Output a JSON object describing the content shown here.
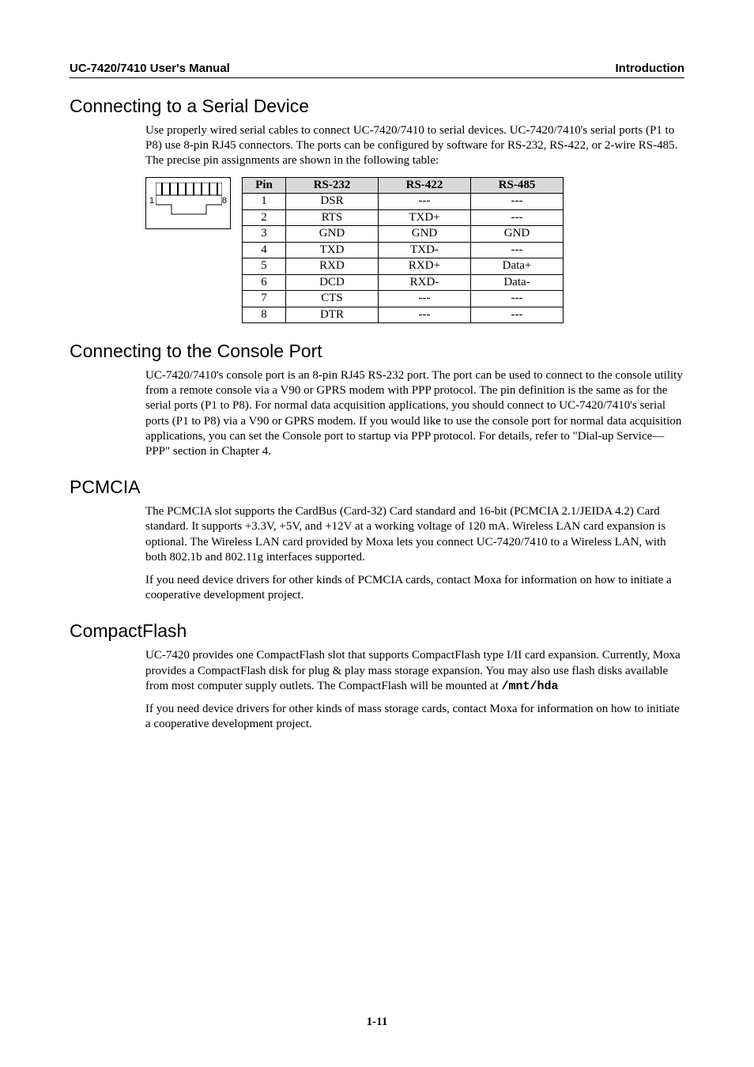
{
  "header": {
    "left": "UC-7420/7410 User's Manual",
    "right": "Introduction"
  },
  "sec1": {
    "title": "Connecting to a Serial Device",
    "para": "Use properly wired serial cables to connect UC-7420/7410 to serial devices. UC-7420/7410's serial ports (P1 to P8) use 8-pin RJ45 connectors. The ports can be configured by software for RS-232, RS-422, or 2-wire RS-485. The precise pin assignments are shown in the following table:"
  },
  "connector": {
    "left_num": "1",
    "right_num": "8"
  },
  "chart_data": {
    "type": "table",
    "title": "RJ45 serial pin assignments",
    "columns": [
      "Pin",
      "RS-232",
      "RS-422",
      "RS-485"
    ],
    "rows": [
      [
        "1",
        "DSR",
        "---",
        "---"
      ],
      [
        "2",
        "RTS",
        "TXD+",
        "---"
      ],
      [
        "3",
        "GND",
        "GND",
        "GND"
      ],
      [
        "4",
        "TXD",
        "TXD-",
        "---"
      ],
      [
        "5",
        "RXD",
        "RXD+",
        "Data+"
      ],
      [
        "6",
        "DCD",
        "RXD-",
        "Data-"
      ],
      [
        "7",
        "CTS",
        "---",
        "---"
      ],
      [
        "8",
        "DTR",
        "---",
        "---"
      ]
    ]
  },
  "sec2": {
    "title": "Connecting to the Console Port",
    "para": "UC-7420/7410's console port is an 8-pin RJ45 RS-232 port. The port can be used to connect to the console utility from a remote console via a V90 or GPRS modem with PPP protocol. The pin definition is the same as for the serial ports (P1 to P8). For normal data acquisition applications, you should connect to UC-7420/7410's serial ports (P1 to P8) via a V90 or GPRS modem. If you would like to use the console port for normal data acquisition applications, you can set the Console port to startup via PPP protocol. For details, refer to \"Dial-up Service—PPP\" section in Chapter 4."
  },
  "sec3": {
    "title": "PCMCIA",
    "p1": "The PCMCIA slot supports the CardBus (Card-32) Card standard and 16-bit (PCMCIA 2.1/JEIDA 4.2) Card standard. It supports +3.3V, +5V, and +12V at a working voltage of 120 mA. Wireless LAN card expansion is optional. The Wireless LAN card provided by Moxa lets you connect UC-7420/7410 to a Wireless LAN, with both 802.1b and 802.11g interfaces supported.",
    "p2": "If you need device drivers for other kinds of PCMCIA cards, contact Moxa for information on how to initiate a cooperative development project."
  },
  "sec4": {
    "title": "CompactFlash",
    "p1a": "UC-7420 provides one CompactFlash slot that supports CompactFlash type I/II card expansion. Currently, Moxa provides a CompactFlash disk for plug & play mass storage expansion. You may also use flash disks available from most computer supply outlets. The CompactFlash will be mounted at ",
    "p1b": "/mnt/hda",
    "p2": "If you need device drivers for other kinds of mass storage cards, contact Moxa for information on how to initiate a cooperative development project."
  },
  "page_num": "1-11"
}
